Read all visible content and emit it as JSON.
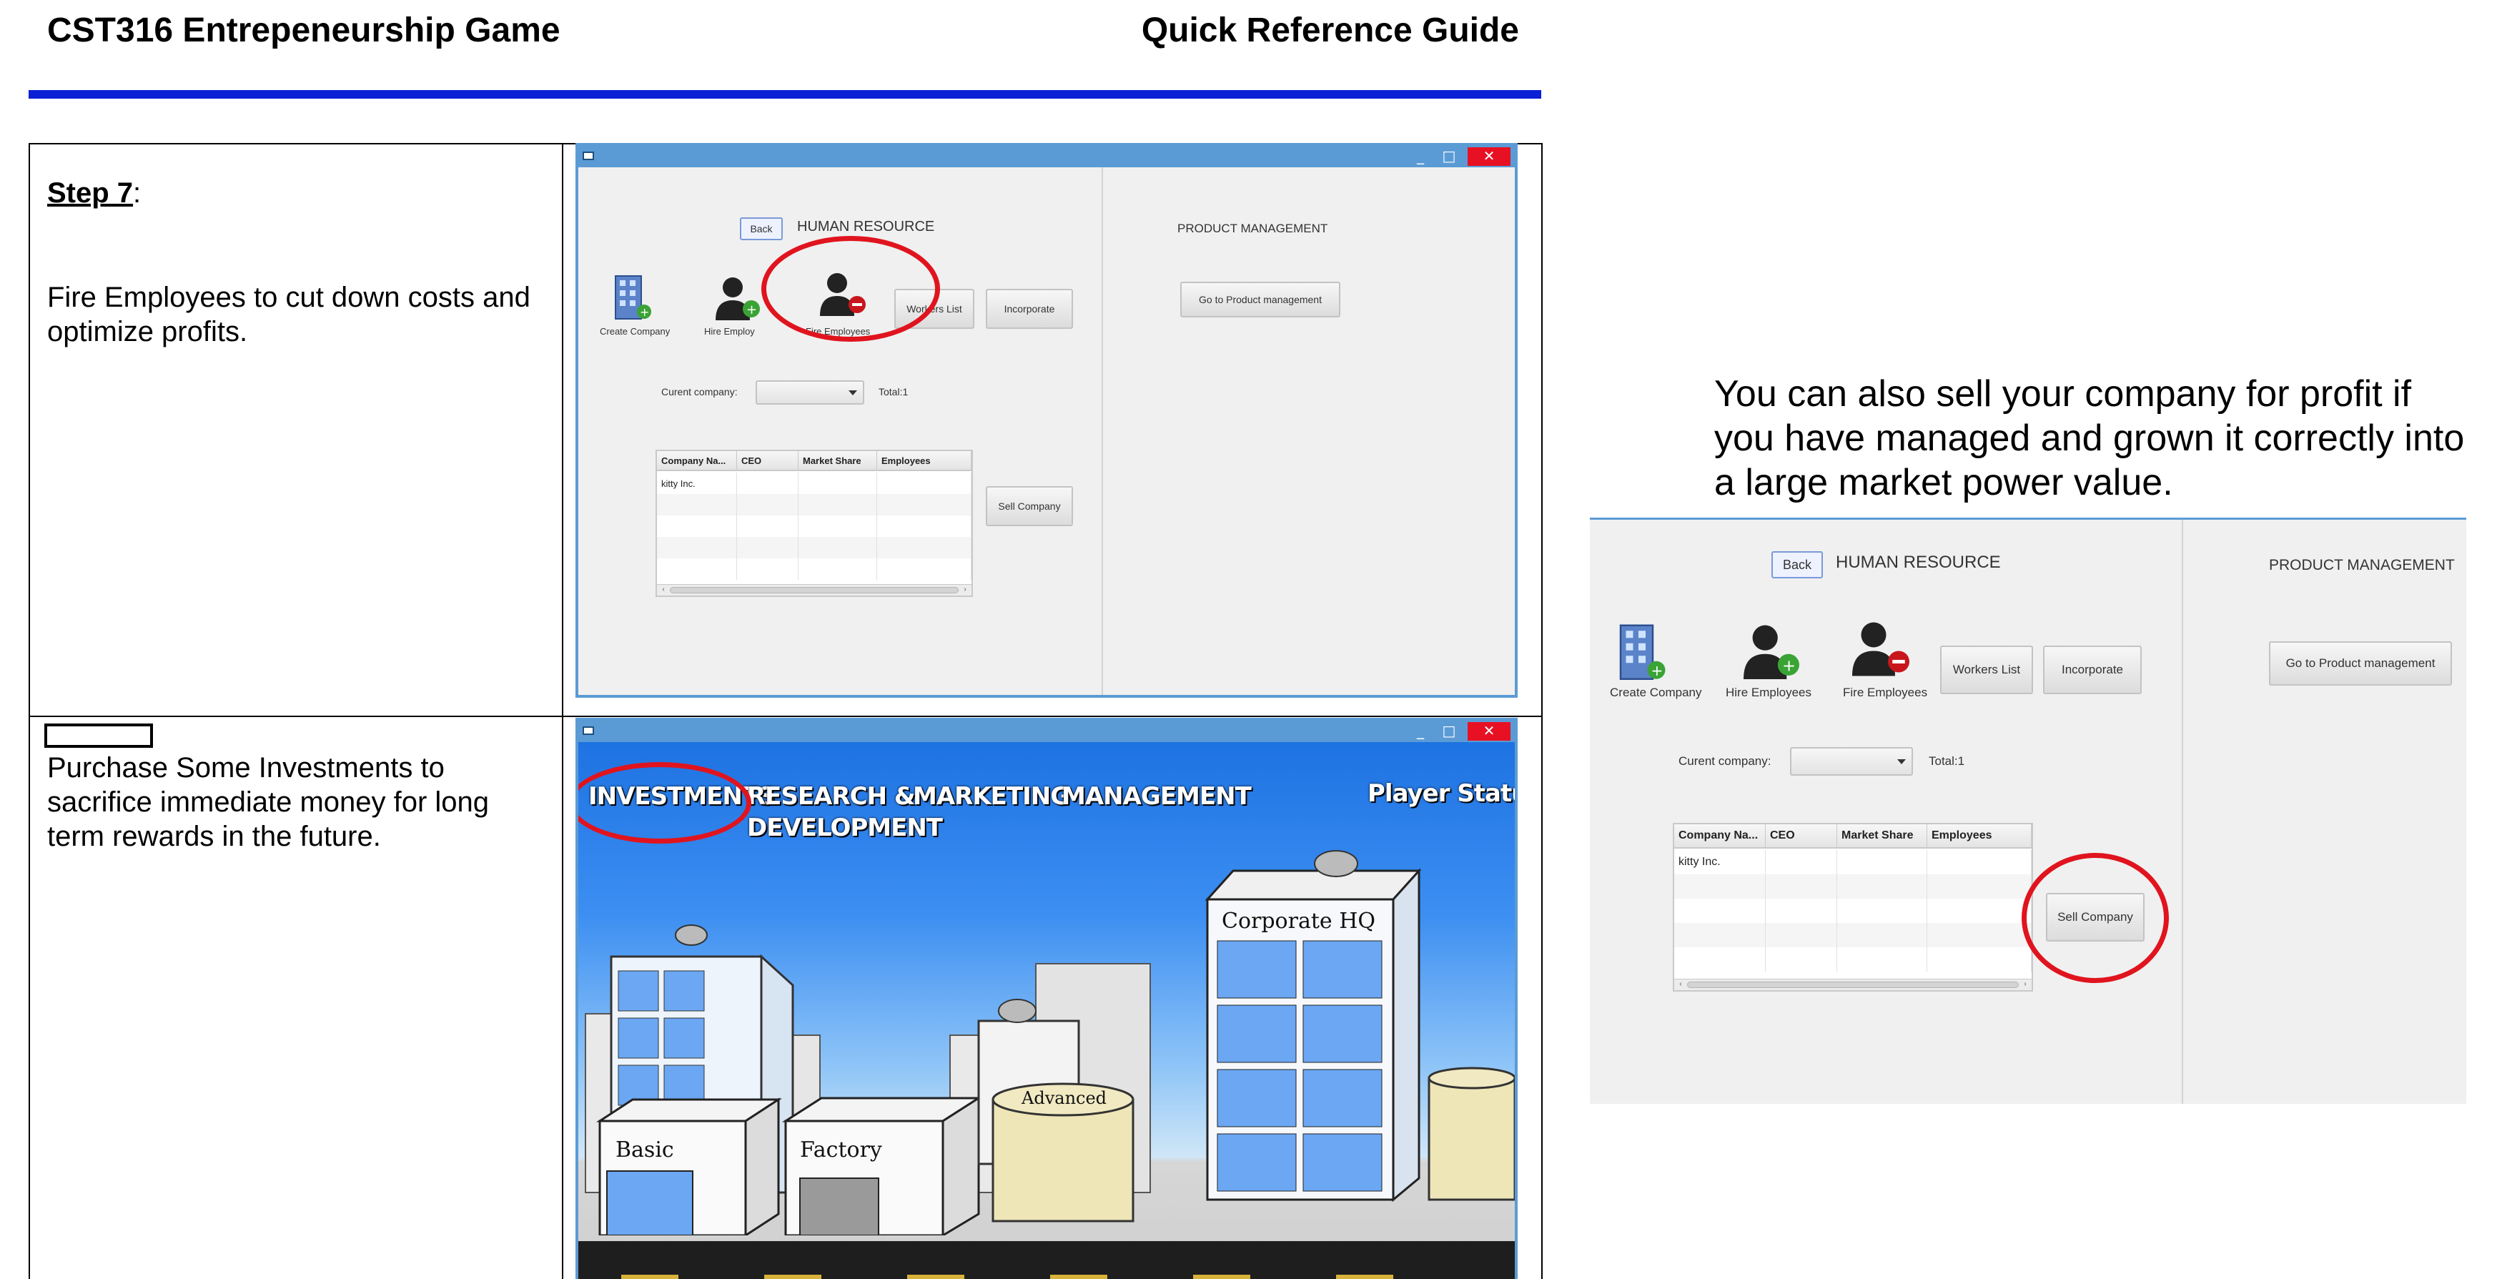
{
  "document": {
    "title": "CST316 Entrepeneurship Game",
    "right_title": "Quick Reference Guide"
  },
  "steps": [
    {
      "label": "Step 7",
      "label_suffix": ":",
      "text": "Fire Employees to cut down costs and optimize profits."
    },
    {
      "label": "",
      "text": "Purchase Some Investments to sacrifice immediate money for long term rewards in the future."
    }
  ],
  "side_note": "You can also sell your company for profit if you have managed and grown it correctly into a large market power value.",
  "app": {
    "window_controls": [
      "_",
      "□",
      "✕"
    ],
    "back_label": "Back",
    "hr_title": "HUMAN RESOURCE",
    "pm_title": "PRODUCT MANAGEMENT",
    "icons": {
      "create_company": "Create Company",
      "hire_employees": "Hire Employees",
      "hire_employees_partial": "Hire Employ",
      "fire_employees": "Fire Employees"
    },
    "workers_list": "Workers List",
    "incorporate": "Incorporate",
    "go_to_pm": "Go to Product management",
    "current_company_label": "Curent company:",
    "total_label": "Total:1",
    "sell_company": "Sell Company",
    "table": {
      "columns": [
        "Company Na...",
        "CEO",
        "Market Share",
        "Employees"
      ],
      "rows": [
        [
          "kitty Inc.",
          "",
          "",
          ""
        ]
      ]
    }
  },
  "game": {
    "menu": {
      "investments": "INVESTMENTS",
      "research_line1": "RESEARCH &",
      "research_line2": "DEVELOPMENT",
      "marketing": "MARKETING",
      "management": "MANAGEMENT",
      "player_status": "Player Status"
    },
    "buildings": {
      "basic": "Basic",
      "factory": "Factory",
      "advanced": "Advanced",
      "corporate": "Corporate HQ"
    }
  },
  "colors": {
    "header_rule": "#0a1fd6",
    "highlight_ring": "#e0141e",
    "window_border": "#5b9bd5",
    "close_button": "#e81123"
  }
}
